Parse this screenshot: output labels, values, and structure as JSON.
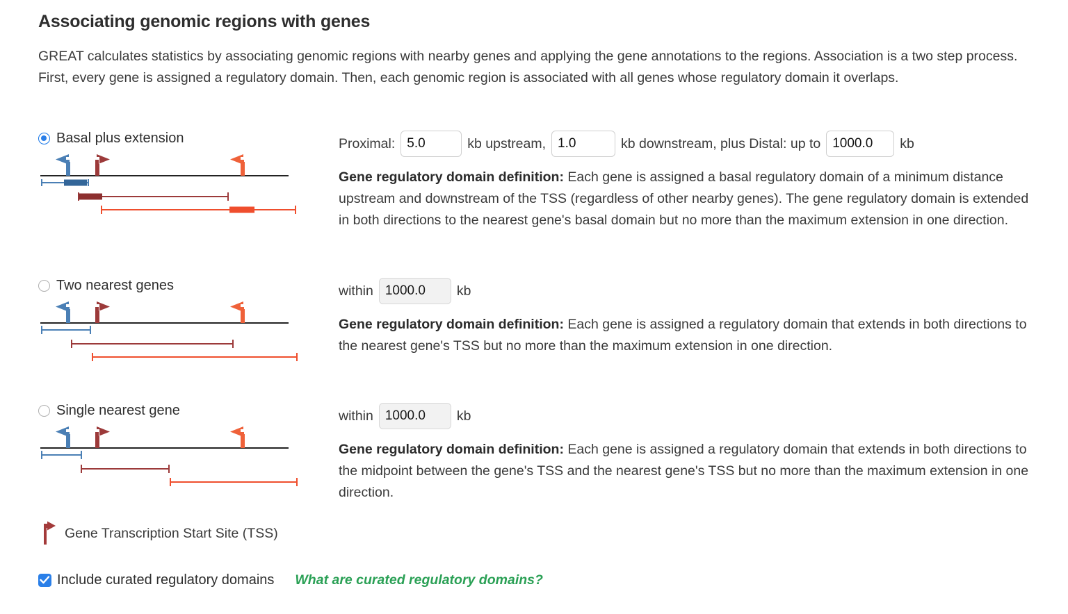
{
  "header": {
    "title": "Associating genomic regions with genes",
    "intro": "GREAT calculates statistics by associating genomic regions with nearby genes and applying the gene annotations to the regions. Association is a two step process. First, every gene is assigned a regulatory domain. Then, each genomic region is associated with all genes whose regulatory domain it overlaps."
  },
  "colors": {
    "blue": "#4a7fb5",
    "dark_red": "#9c3a3a",
    "orange": "#ef6139",
    "axis": "#333333",
    "accent_blue": "#2a7fe8",
    "link_green": "#2aa055"
  },
  "options": [
    {
      "id": "basal-plus-extension",
      "label": "Basal plus extension",
      "selected": true,
      "fields": {
        "proximal_label": "Proximal:",
        "upstream_value": "5.0",
        "upstream_unit": "kb upstream,",
        "downstream_value": "1.0",
        "downstream_unit": "kb downstream, plus Distal: up to",
        "distal_value": "1000.0",
        "distal_unit": "kb"
      },
      "definition_title": "Gene regulatory domain definition:",
      "definition_body": " Each gene is assigned a basal regulatory domain of a minimum distance upstream and downstream of the TSS (regardless of other nearby genes). The gene regulatory domain is extended in both directions to the nearest gene's basal domain but no more than the maximum extension in one direction."
    },
    {
      "id": "two-nearest-genes",
      "label": "Two nearest genes",
      "selected": false,
      "fields": {
        "within_label": "within",
        "within_value": "1000.0",
        "within_unit": "kb"
      },
      "definition_title": "Gene regulatory domain definition:",
      "definition_body": " Each gene is assigned a regulatory domain that extends in both directions to the nearest gene's TSS but no more than the maximum extension in one direction."
    },
    {
      "id": "single-nearest-gene",
      "label": "Single nearest gene",
      "selected": false,
      "fields": {
        "within_label": "within",
        "within_value": "1000.0",
        "within_unit": "kb"
      },
      "definition_title": "Gene regulatory domain definition:",
      "definition_body": " Each gene is assigned a regulatory domain that extends in both directions to the midpoint between the gene's TSS and the nearest gene's TSS but no more than the maximum extension in one direction."
    }
  ],
  "legend": {
    "icon": "tss-flag-icon",
    "text": "Gene Transcription Start Site (TSS)"
  },
  "footer": {
    "checkbox_checked": true,
    "checkbox_label": "Include curated regulatory domains",
    "link_text": "What are curated regulatory domains?"
  }
}
